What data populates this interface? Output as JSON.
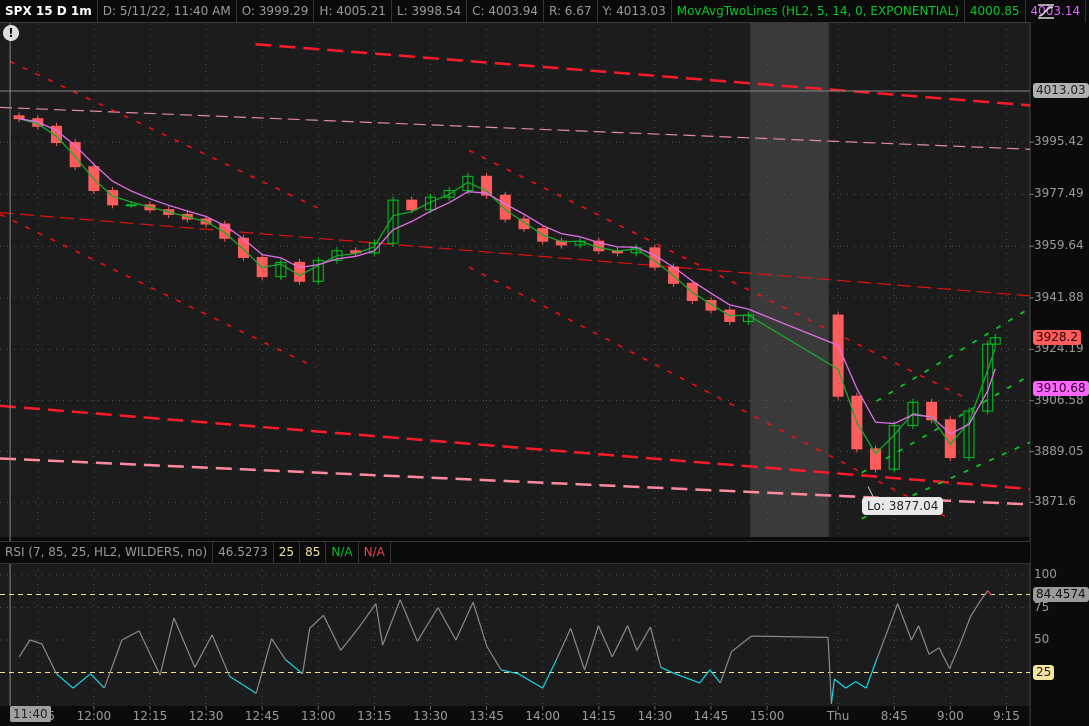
{
  "header": {
    "symbol": "SPX 15 D 1m",
    "date": "D: 5/11/22, 11:40 AM",
    "open": "O: 3999.29",
    "high": "H: 4005.21",
    "low": "L: 3998.54",
    "close": "C: 4003.94",
    "range": "R: 6.67",
    "y": "Y: 4013.03",
    "study": "MovAvgTwoLines (HL2, 5, 14, 0, EXPONENTIAL)",
    "ma_fast": "4000.85",
    "ma_slow": "4003.14"
  },
  "alert_icon": "!",
  "rsi_header": {
    "label": "RSI (7, 85, 25, HL2, WILDERS, no)",
    "value": "46.5273",
    "oversold": "25",
    "overbought": "85",
    "na1": "N/A",
    "na2": "N/A"
  },
  "cursor": {
    "time_label": "11:40",
    "price_label": "4013.03"
  },
  "annotation": {
    "low_label": "Lo: 3877.04"
  },
  "colors": {
    "background": "#1c1c1c",
    "up": "#00c81e",
    "down": "#ff5c5c",
    "ema_fast": "#17a82b",
    "ema_slow": "#e070e8",
    "rsi": "#8a8a8a",
    "rsi_low": "#19d6e6",
    "rsi_high": "#ff4040",
    "level": "#f0e08a"
  },
  "chart_data": [
    {
      "type": "candlestick",
      "title": "SPX 15 D 1m",
      "x_unit": "minutes since 11:40 (session gap compressed)",
      "bar_minutes": 5,
      "ema_periods": [
        5,
        14
      ],
      "ylim": [
        3859.7,
        4036.4
      ],
      "xlim": [
        -5.1,
        270.3
      ],
      "session_gap": [
        195.5,
        216.5
      ],
      "series": [
        {
          "t": 0,
          "time": "11:40",
          "close": 4003.5
        },
        {
          "t": 5,
          "time": "11:45",
          "close": 4000.9
        },
        {
          "t": 10,
          "time": "11:50",
          "close": 3995.3
        },
        {
          "t": 15,
          "time": "11:55",
          "close": 3987.0
        },
        {
          "t": 20,
          "time": "12:00",
          "close": 3978.8
        },
        {
          "t": 25,
          "time": "12:05",
          "close": 3973.9
        },
        {
          "t": 30,
          "time": "12:10",
          "close": 3973.9
        },
        {
          "t": 35,
          "time": "12:15",
          "close": 3972.2
        },
        {
          "t": 40,
          "time": "12:20",
          "close": 3970.6
        },
        {
          "t": 45,
          "time": "12:25",
          "close": 3969.0
        },
        {
          "t": 50,
          "time": "12:30",
          "close": 3967.3
        },
        {
          "t": 55,
          "time": "12:35",
          "close": 3962.4
        },
        {
          "t": 60,
          "time": "12:40",
          "close": 3955.8
        },
        {
          "t": 65,
          "time": "12:45",
          "close": 3949.2
        },
        {
          "t": 70,
          "time": "12:50",
          "close": 3954.1
        },
        {
          "t": 75,
          "time": "12:55",
          "close": 3947.6
        },
        {
          "t": 80,
          "time": "13:00",
          "close": 3954.8
        },
        {
          "t": 85,
          "time": "13:05",
          "close": 3958.1
        },
        {
          "t": 90,
          "time": "13:10",
          "close": 3957.4
        },
        {
          "t": 95,
          "time": "13:15",
          "close": 3960.7
        },
        {
          "t": 100,
          "time": "13:20",
          "close": 3975.5
        },
        {
          "t": 105,
          "time": "13:25",
          "close": 3972.2
        },
        {
          "t": 110,
          "time": "13:30",
          "close": 3976.5
        },
        {
          "t": 115,
          "time": "13:35",
          "close": 3978.8
        },
        {
          "t": 120,
          "time": "13:40",
          "close": 3983.7
        },
        {
          "t": 125,
          "time": "13:45",
          "close": 3977.2
        },
        {
          "t": 130,
          "time": "13:50",
          "close": 3969.0
        },
        {
          "t": 135,
          "time": "13:55",
          "close": 3965.7
        },
        {
          "t": 140,
          "time": "14:00",
          "close": 3961.4
        },
        {
          "t": 145,
          "time": "14:05",
          "close": 3960.1
        },
        {
          "t": 150,
          "time": "14:10",
          "close": 3961.4
        },
        {
          "t": 155,
          "time": "14:15",
          "close": 3958.1
        },
        {
          "t": 160,
          "time": "14:20",
          "close": 3957.4
        },
        {
          "t": 165,
          "time": "14:25",
          "close": 3959.1
        },
        {
          "t": 170,
          "time": "14:30",
          "close": 3952.5
        },
        {
          "t": 175,
          "time": "14:35",
          "close": 3946.9
        },
        {
          "t": 180,
          "time": "14:40",
          "close": 3941.0
        },
        {
          "t": 185,
          "time": "14:45",
          "close": 3937.7
        },
        {
          "t": 190,
          "time": "14:50",
          "close": 3933.8
        },
        {
          "t": 195,
          "time": "14:55",
          "close": 3936.0
        },
        {
          "t": 219,
          "time": "8:30",
          "close": 3908.1
        },
        {
          "t": 224,
          "time": "8:35",
          "close": 3890.0
        },
        {
          "t": 229,
          "time": "8:40",
          "close": 3883.0
        },
        {
          "t": 234,
          "time": "8:45",
          "close": 3898.0
        },
        {
          "t": 239,
          "time": "8:50",
          "close": 3906.0
        },
        {
          "t": 244,
          "time": "8:55",
          "close": 3900.0
        },
        {
          "t": 249,
          "time": "9:00",
          "close": 3887.0
        },
        {
          "t": 254,
          "time": "9:05",
          "close": 3903.0
        },
        {
          "t": 259,
          "time": "9:10",
          "close": 3926.0
        },
        {
          "t": 261,
          "time": "9:12",
          "close": 3928.2
        }
      ],
      "low_point": {
        "t": 227,
        "price": 3877.04
      },
      "crosshair": {
        "t": -2.4,
        "price": 4013.03
      },
      "drawings": [
        {
          "style": "red-long",
          "from": [
            63.2,
            4029.1
          ],
          "to": [
            270.3,
            4008.1
          ]
        },
        {
          "style": "pink-thin",
          "from": [
            -5.1,
            4007.4
          ],
          "to": [
            270.3,
            3993.0
          ]
        },
        {
          "style": "red-mid",
          "from": [
            -5.1,
            3971.2
          ],
          "to": [
            270.3,
            3942.6
          ]
        },
        {
          "style": "red-long",
          "from": [
            -5.1,
            3904.8
          ],
          "to": [
            270.3,
            3876.2
          ]
        },
        {
          "style": "pink-long",
          "from": [
            -5.1,
            3886.7
          ],
          "to": [
            270.3,
            3870.9
          ]
        },
        {
          "style": "red-dot",
          "from": [
            -2.4,
            4023.2
          ],
          "to": [
            79.8,
            3972.9
          ]
        },
        {
          "style": "red-dot",
          "from": [
            -5.1,
            3970.6
          ],
          "to": [
            79.3,
            3918.0
          ]
        },
        {
          "style": "red-dot",
          "from": [
            120.3,
            3992.6
          ],
          "to": [
            252.1,
            3908.1
          ]
        },
        {
          "style": "red-dot",
          "from": [
            120.3,
            3952.5
          ],
          "to": [
            248.9,
            3866.0
          ]
        },
        {
          "style": "green-dot",
          "from": [
            229.3,
            3906.4
          ],
          "to": [
            270.3,
            3938.4
          ]
        },
        {
          "style": "green-dot",
          "from": [
            225.3,
            3881.8
          ],
          "to": [
            270.3,
            3915.3
          ]
        },
        {
          "style": "green-dot",
          "from": [
            225.3,
            3866.0
          ],
          "to": [
            270.3,
            3892.3
          ]
        }
      ],
      "y_ticks": [
        3995.42,
        3977.49,
        3959.64,
        3941.88,
        3924.19,
        3906.58,
        3889.05,
        3871.6
      ],
      "y_markers": [
        {
          "label": "4013.03",
          "value": 4013.03,
          "bg": "#b0b0b0",
          "fg": "#222222"
        },
        {
          "label": "3928.2",
          "value": 3928.2,
          "bg": "#ff5c5c",
          "fg": "#2a0000"
        },
        {
          "label": "3910.68",
          "value": 3910.68,
          "bg": "#ff66ff",
          "fg": "#2a002a"
        }
      ],
      "x_ticks": [
        {
          "t": 5,
          "label": "11:45"
        },
        {
          "t": 20,
          "label": "12:00"
        },
        {
          "t": 35,
          "label": "12:15"
        },
        {
          "t": 50,
          "label": "12:30"
        },
        {
          "t": 65,
          "label": "12:45"
        },
        {
          "t": 80,
          "label": "13:00"
        },
        {
          "t": 95,
          "label": "13:15"
        },
        {
          "t": 110,
          "label": "13:30"
        },
        {
          "t": 125,
          "label": "13:45"
        },
        {
          "t": 140,
          "label": "14:00"
        },
        {
          "t": 155,
          "label": "14:15"
        },
        {
          "t": 170,
          "label": "14:30"
        },
        {
          "t": 185,
          "label": "14:45"
        },
        {
          "t": 200,
          "label": "15:00"
        },
        {
          "t": 219,
          "label": "Thu"
        },
        {
          "t": 234,
          "label": "8:45"
        },
        {
          "t": 249,
          "label": "9:00"
        },
        {
          "t": 264,
          "label": "9:15"
        }
      ]
    },
    {
      "type": "line",
      "title": "RSI (7, 85, 25, HL2, WILDERS, no)",
      "ylim": [
        0,
        100
      ],
      "levels": [
        85,
        25
      ],
      "y_ticks": [
        100,
        75,
        50
      ],
      "y_markers": [
        {
          "label": "84.4574",
          "value": 84.4574,
          "bg": "#9a9a9a",
          "fg": "#111111"
        },
        {
          "label": "25",
          "value": 25,
          "bg": "#f4e4a0",
          "fg": "#222222"
        }
      ],
      "points": [
        [
          0,
          37
        ],
        [
          2.9,
          50
        ],
        [
          6.1,
          47
        ],
        [
          10,
          24
        ],
        [
          14.4,
          13
        ],
        [
          19.1,
          24
        ],
        [
          22.8,
          13
        ],
        [
          27.5,
          50
        ],
        [
          32.1,
          57
        ],
        [
          37.7,
          23
        ],
        [
          41.4,
          67
        ],
        [
          47,
          29
        ],
        [
          51.6,
          54
        ],
        [
          56.3,
          22
        ],
        [
          63.4,
          9
        ],
        [
          67.5,
          51
        ],
        [
          71.2,
          35
        ],
        [
          75.8,
          24
        ],
        [
          77.7,
          59
        ],
        [
          81.4,
          69
        ],
        [
          86,
          42
        ],
        [
          90.7,
          59
        ],
        [
          95.4,
          78
        ],
        [
          97.2,
          46
        ],
        [
          101.9,
          81
        ],
        [
          106.5,
          49
        ],
        [
          112,
          75
        ],
        [
          116.8,
          50
        ],
        [
          121.4,
          79
        ],
        [
          125.1,
          45
        ],
        [
          128.9,
          27
        ],
        [
          133.5,
          24
        ],
        [
          140,
          13
        ],
        [
          143.7,
          35
        ],
        [
          147.5,
          59
        ],
        [
          151.2,
          27
        ],
        [
          154.9,
          61
        ],
        [
          158.6,
          37
        ],
        [
          162.7,
          61
        ],
        [
          165.2,
          42
        ],
        [
          168.8,
          60
        ],
        [
          171.6,
          29
        ],
        [
          175.4,
          24
        ],
        [
          182,
          17
        ],
        [
          184.7,
          27
        ],
        [
          187.5,
          17
        ],
        [
          190.5,
          41
        ],
        [
          195.8,
          53
        ],
        [
          216.3,
          52
        ],
        [
          217.2,
          1
        ],
        [
          218,
          20
        ],
        [
          221,
          13
        ],
        [
          223.7,
          18
        ],
        [
          226.5,
          13
        ],
        [
          229.3,
          35
        ],
        [
          232.2,
          57
        ],
        [
          234.9,
          78
        ],
        [
          238.6,
          50
        ],
        [
          240.5,
          61
        ],
        [
          243.3,
          39
        ],
        [
          246,
          44
        ],
        [
          248.8,
          28
        ],
        [
          251.6,
          47
        ],
        [
          254.4,
          68
        ],
        [
          257.2,
          81
        ],
        [
          259,
          88
        ],
        [
          260,
          84.4574
        ]
      ]
    }
  ]
}
